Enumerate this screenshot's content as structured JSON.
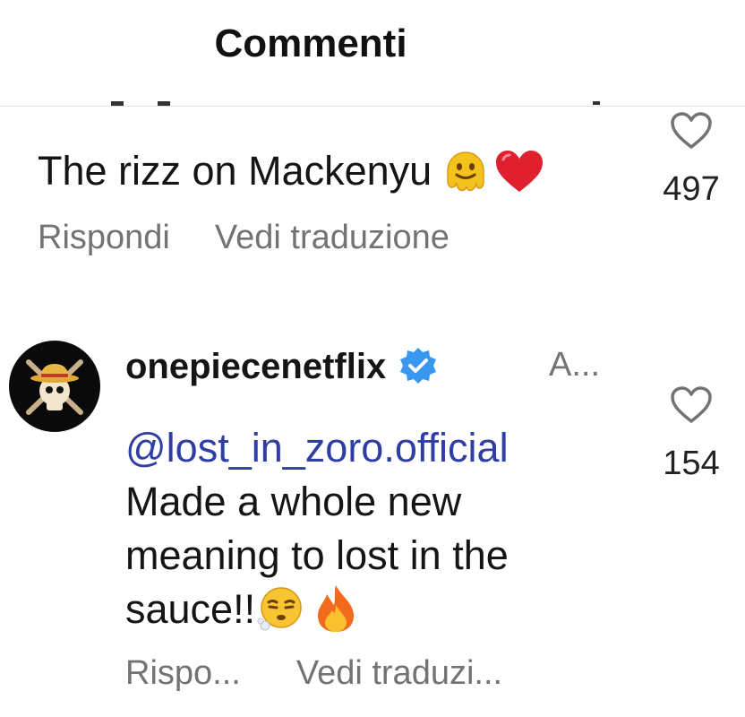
{
  "header": {
    "title": "Commenti"
  },
  "comments": [
    {
      "text": "The rizz on Mackenyu",
      "emojis": [
        "melting-face-icon",
        "red-heart-icon"
      ],
      "reply_label": "Rispondi",
      "translate_label": "Vedi traduzione",
      "likes": "497"
    },
    {
      "username": "onepiecenetflix",
      "verified": true,
      "time": "A...",
      "mention": "@lost_in_zoro.official",
      "text": "Made a whole new meaning to lost in the sauce!!",
      "emojis": [
        "face-exhaling-icon",
        "fire-icon"
      ],
      "reply_label": "Rispo...",
      "translate_label": "Vedi traduzi...",
      "likes": "154"
    }
  ],
  "colors": {
    "text": "#151515",
    "secondary": "#737373",
    "mention": "#2f3ea5",
    "verified": "#3897f0",
    "heart": "#e0202f"
  }
}
